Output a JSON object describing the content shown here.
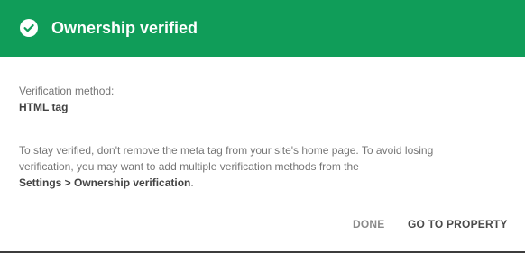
{
  "header": {
    "title": "Ownership verified",
    "icon": "check-circle-icon",
    "background_color": "#109d59"
  },
  "verification": {
    "label": "Verification method:",
    "value": "HTML tag"
  },
  "info": {
    "line1": "To stay verified, don't remove the meta tag from your site's home page. To avoid losing",
    "line2": "verification, you may want to add multiple verification methods from the",
    "line3_link": "Settings > Ownership verification",
    "line3_end": "."
  },
  "actions": {
    "done_label": "DONE",
    "go_label": "GO TO PROPERTY"
  }
}
